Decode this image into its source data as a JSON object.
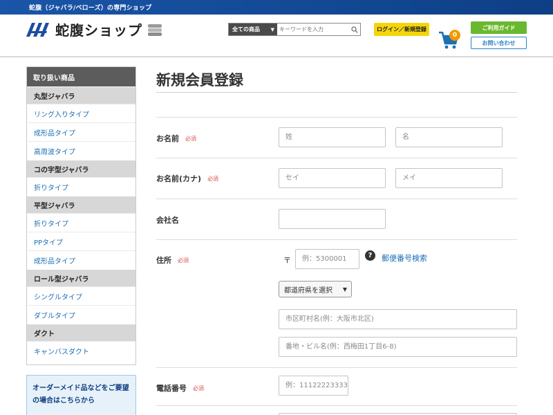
{
  "topbar": {
    "text": "蛇腹（ジャバラ/ベローズ）の専門ショップ"
  },
  "header": {
    "logo_text": "蛇腹ショップ",
    "search": {
      "category": "全ての商品",
      "placeholder": "キーワードを入力"
    },
    "login_label": "ログイン／新規登録",
    "cart_count": "0",
    "guide_label": "ご利用ガイド",
    "contact_label": "お問い合わせ"
  },
  "sidebar": {
    "heading": "取り扱い商品",
    "groups": [
      {
        "category": "丸型ジャバラ",
        "items": [
          "リング入りタイプ",
          "成形品タイプ",
          "高周波タイプ"
        ]
      },
      {
        "category": "コの字型ジャバラ",
        "items": [
          "折りタイプ"
        ]
      },
      {
        "category": "平型ジャバラ",
        "items": [
          "折りタイプ",
          "PPタイプ",
          "成形品タイプ"
        ]
      },
      {
        "category": "ロール型ジャバラ",
        "items": [
          "シングルタイプ",
          "ダブルタイプ"
        ]
      },
      {
        "category": "ダクト",
        "items": [
          "キャンバスダクト"
        ]
      }
    ],
    "order_box": {
      "line1": "オーダーメイド品などをご要望",
      "line2": "の場合はこちらから"
    }
  },
  "main": {
    "title": "新規会員登録",
    "required_label": "必須",
    "name": {
      "label": "お名前",
      "last_placeholder": "姓",
      "first_placeholder": "名"
    },
    "kana": {
      "label": "お名前(カナ)",
      "last_placeholder": "セイ",
      "first_placeholder": "メイ"
    },
    "company": {
      "label": "会社名"
    },
    "address": {
      "label": "住所",
      "zip_mark": "〒",
      "zip_placeholder": "例：5300001",
      "help_icon": "?",
      "zip_search": "郵便番号検索",
      "pref_select": "都道府県を選択",
      "city_placeholder": "市区町村名(例：大阪市北区)",
      "street_placeholder": "番地・ビル名(例：西梅田1丁目6-8)"
    },
    "phone": {
      "label": "電話番号",
      "placeholder": "例：11122223333"
    }
  },
  "colors": {
    "topbar": "#1a55a8",
    "login": "#f6d40a",
    "guide": "#69b82d",
    "link": "#1c6fb5",
    "required": "#d9534f",
    "cart": "#1c6fb5",
    "badge": "#f39800"
  },
  "icons": [
    "logo-mark-icon",
    "pipe-icon",
    "search-icon",
    "cart-icon",
    "help-icon",
    "chevron-down-icon"
  ]
}
